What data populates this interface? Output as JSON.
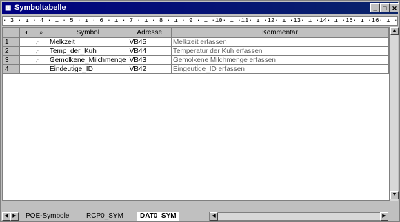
{
  "window": {
    "title": "Symboltabelle"
  },
  "ruler": {
    "text": "· 3 · ı · 4 · ı · 5 · ı · 6 · ı · 7 · ı · 8 · ı · 9 · ı ·10· ı ·11· ı ·12· ı ·13· ı ·14· ı ·15· ı ·16· ı ·17· ı ·18· ı"
  },
  "table": {
    "headers": {
      "symbol": "Symbol",
      "adresse": "Adresse",
      "kommentar": "Kommentar"
    },
    "rows": [
      {
        "num": "1",
        "symbol": "Melkzeit",
        "adresse": "VB45",
        "kommentar": "Melkzeit erfassen"
      },
      {
        "num": "2",
        "symbol": "Temp_der_Kuh",
        "adresse": "VB44",
        "kommentar": "Temperatur der Kuh erfassen"
      },
      {
        "num": "3",
        "symbol": "Gemolkene_Milchmenge",
        "adresse": "VB43",
        "kommentar": "Gemolkene Milchmenge erfassen"
      },
      {
        "num": "4",
        "symbol": "Eindeutige_ID",
        "adresse": "VB42",
        "kommentar": "Eingeutige_ID erfassen"
      }
    ]
  },
  "tabs": {
    "poe": "POE-Symbole",
    "rcp": "RCP0_SYM",
    "dat": "DAT0_SYM"
  }
}
